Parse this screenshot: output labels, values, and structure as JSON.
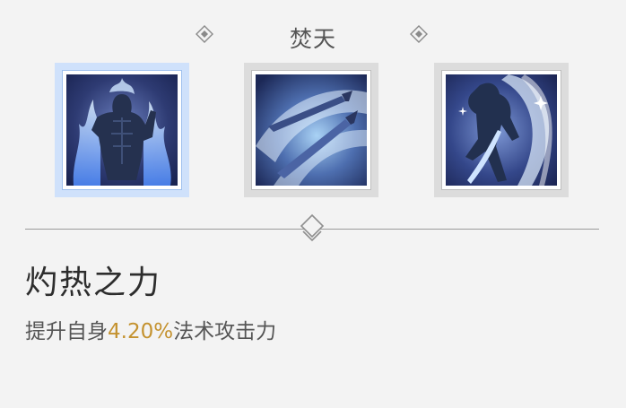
{
  "header": {
    "title": "焚天"
  },
  "skills": [
    {
      "icon": "flame-body-icon",
      "selected": true
    },
    {
      "icon": "twin-swords-icon",
      "selected": false
    },
    {
      "icon": "blade-slash-icon",
      "selected": false
    }
  ],
  "detail": {
    "name": "灼热之力",
    "desc_prefix": "提升自身",
    "desc_value": "4.20%",
    "desc_suffix": "法术攻击力"
  },
  "colors": {
    "background": "#f3f3f3",
    "highlight_value": "#c4922f",
    "selected_border": "#cfe1fb"
  }
}
